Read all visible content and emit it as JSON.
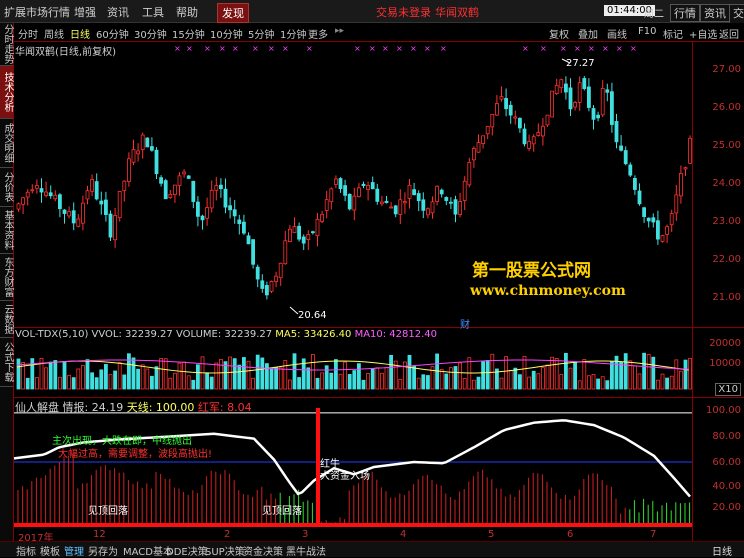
{
  "menubar": {
    "items": [
      "扩展市场行情",
      "增强",
      "资讯",
      "工具",
      "帮助"
    ],
    "active_item": "发现",
    "status_red_1": "交易未登录",
    "status_red_2": "华闻双鹤",
    "clock": "01:44:00",
    "weekday": "周二",
    "right_buttons": [
      "行情",
      "资讯",
      "交易"
    ]
  },
  "periods": {
    "items": [
      "分时",
      "周线",
      "日线",
      "60分钟",
      "30分钟",
      "15分钟",
      "10分钟",
      "5分钟",
      "1分钟",
      "更多"
    ],
    "active": "日线",
    "right_items": [
      "复权",
      "叠加",
      "画线",
      "F10",
      "标记",
      "+自选",
      "返回"
    ]
  },
  "left_tabs": [
    "分时走势",
    "技术分析",
    "成交明细",
    "分价表",
    "基本资料",
    "东方财富",
    "云数据",
    "公式下载"
  ],
  "left_tab_active": "技术分析",
  "chart_title": "华闻双鹤(日线,前复权)",
  "chart_data": [
    {
      "type": "candlestick",
      "title": "华闻双鹤(日线,前复权)",
      "y_ticks": [
        "27.00",
        "26.00",
        "25.00",
        "24.00",
        "23.00",
        "22.00",
        "21.00"
      ],
      "ylim": [
        20.4,
        27.6
      ],
      "annotations": [
        "27.27",
        "20.64",
        "财"
      ],
      "high_label": "27.27",
      "low_label": "20.64"
    },
    {
      "type": "bar",
      "title": "VOL-TDX(5,10)",
      "legend": {
        "vvol": "VVOL: 32239.27",
        "volume": "VOLUME: 32239.27",
        "ma5": "MA5: 33426.40",
        "ma10": "MA10: 42812.40"
      },
      "y_ticks": [
        "20000",
        "10000",
        "X10"
      ],
      "ylim": [
        0,
        22000
      ]
    },
    {
      "type": "area",
      "title": "仙人解盘",
      "legend": {
        "qingbao": "情报: 24.19",
        "tianxian": "天线: 100.00",
        "hongjun": "红军: 8.04"
      },
      "y_ticks": [
        "100.00",
        "80.00",
        "60.00",
        "40.00",
        "20.00"
      ],
      "ylim": [
        8,
        108
      ],
      "annotations": {
        "green_text": "主次出现，大跌在即，中线抛出",
        "red_text": "大幅过高，需要调整，波段高抛出!",
        "peak_1": "见顶回落",
        "peak_2": "见顶回落",
        "bull_1": "红牛",
        "bull_2": "大资金入场"
      },
      "x_ticks": [
        "2017年",
        "12",
        "2",
        "3",
        "4",
        "5",
        "6",
        "7"
      ]
    }
  ],
  "watermark": {
    "line1": "第一股票公式网",
    "line2": "www.chnmoney.com"
  },
  "bottom_tabs": [
    "指标",
    "模板",
    "管理",
    "另存为",
    "MACD基本",
    "DDE决策",
    "SUP决策",
    "资金决策",
    "黑牛战法"
  ],
  "bottom_tab_active": "管理",
  "bottom_right": "日线"
}
